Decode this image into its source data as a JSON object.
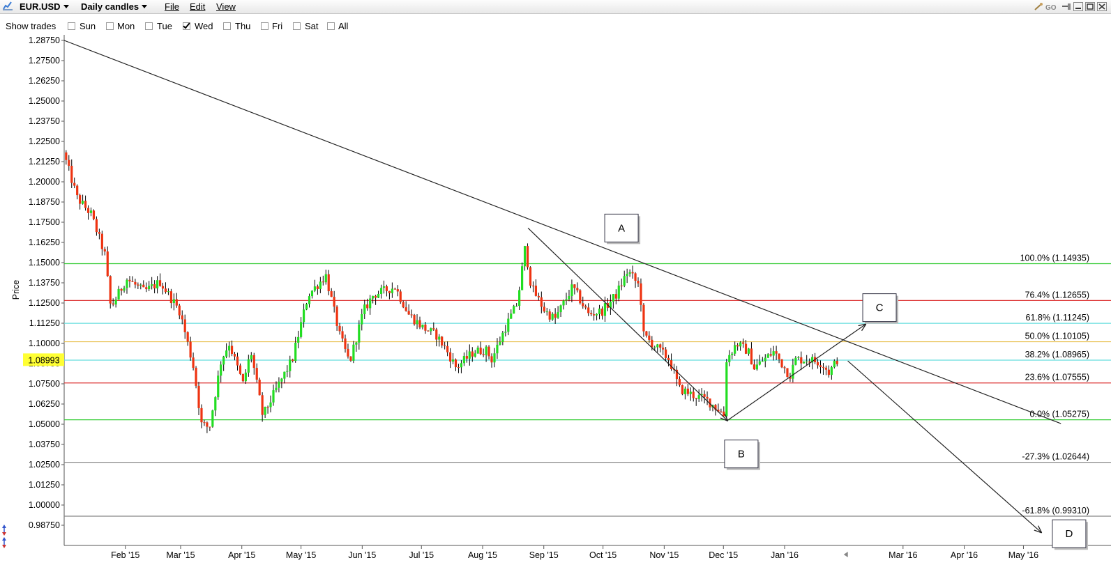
{
  "titlebar": {
    "symbol": "EUR.USD",
    "timeframe": "Daily candles",
    "menus": [
      "File",
      "Edit",
      "View"
    ]
  },
  "trades_bar": {
    "label": "Show trades",
    "options": [
      {
        "label": "Sun",
        "checked": false
      },
      {
        "label": "Mon",
        "checked": false
      },
      {
        "label": "Tue",
        "checked": false
      },
      {
        "label": "Wed",
        "checked": true
      },
      {
        "label": "Thu",
        "checked": false
      },
      {
        "label": "Fri",
        "checked": false
      },
      {
        "label": "Sat",
        "checked": false
      },
      {
        "label": "All",
        "checked": false
      }
    ]
  },
  "colors": {
    "up_candle": "#22dd22",
    "down_candle": "#ee3311",
    "green_level": "#33cc33",
    "red_level": "#dd3333",
    "cyan_level": "#66dddd",
    "orange_level": "#e8c050",
    "gray_level": "#888888",
    "price_badge": "#ffff33"
  },
  "chart_data": {
    "type": "candlestick",
    "ylabel": "Price",
    "ylim": [
      0.98,
      1.29375
    ],
    "y_ticks": [
      "1.28750",
      "1.27500",
      "1.26250",
      "1.25000",
      "1.23750",
      "1.22500",
      "1.21250",
      "1.20000",
      "1.18750",
      "1.17500",
      "1.16250",
      "1.15000",
      "1.13750",
      "1.12500",
      "1.11250",
      "1.10000",
      "1.08750",
      "1.07500",
      "1.06250",
      "1.05000",
      "1.03750",
      "1.02500",
      "1.01250",
      "1.00000",
      "0.98750"
    ],
    "x_ticks": [
      "Feb '15",
      "Mar '15",
      "Apr '15",
      "May '15",
      "Jun '15",
      "Jul '15",
      "Aug '15",
      "Sep '15",
      "Oct '15",
      "Nov '15",
      "Dec '15",
      "Jan '16",
      "Mar '16",
      "Apr '16",
      "May '16"
    ],
    "current_price": "1.08993",
    "fib_levels": [
      {
        "label": "100.0% (1.14935)",
        "value": 1.14935,
        "color": "green"
      },
      {
        "label": "76.4% (1.12655)",
        "value": 1.12655,
        "color": "red"
      },
      {
        "label": "61.8% (1.11245)",
        "value": 1.11245,
        "color": "cyan"
      },
      {
        "label": "50.0% (1.10105)",
        "value": 1.10105,
        "color": "orange"
      },
      {
        "label": "38.2% (1.08965)",
        "value": 1.08965,
        "color": "cyan"
      },
      {
        "label": "23.6% (1.07555)",
        "value": 1.07555,
        "color": "red"
      },
      {
        "label": "0.0% (1.05275)",
        "value": 1.05275,
        "color": "green"
      },
      {
        "label": "-27.3% (1.02644)",
        "value": 1.02644,
        "color": "gray"
      },
      {
        "label": "-61.8% (0.99310)",
        "value": 0.9931,
        "color": "gray"
      }
    ],
    "trendline": {
      "from": {
        "date": "2015-01-01",
        "price": 1.2875
      },
      "to": {
        "date": "2016-05-20",
        "price": 1.0504
      }
    },
    "pattern_points": [
      {
        "label": "A",
        "date": "2015-08-24",
        "price": 1.1714
      },
      {
        "label": "B",
        "date": "2015-12-03",
        "price": 1.0523
      },
      {
        "label": "C",
        "date": "2016-02-11",
        "price": 1.1118
      },
      {
        "label": "D",
        "date": "2016-05-10",
        "price": 0.9831
      }
    ],
    "extra_line": {
      "from": {
        "date": "2016-02-02",
        "price": 1.0892
      },
      "to": {
        "date": "2016-05-10",
        "price": 0.9831
      }
    },
    "anchors": [
      {
        "date": "2015-01-02",
        "price": 1.2182
      },
      {
        "date": "2015-01-09",
        "price": 1.19
      },
      {
        "date": "2015-01-16",
        "price": 1.18
      },
      {
        "date": "2015-01-23",
        "price": 1.155
      },
      {
        "date": "2015-01-26",
        "price": 1.122
      },
      {
        "date": "2015-02-03",
        "price": 1.14
      },
      {
        "date": "2015-02-12",
        "price": 1.132
      },
      {
        "date": "2015-02-20",
        "price": 1.138
      },
      {
        "date": "2015-03-02",
        "price": 1.12
      },
      {
        "date": "2015-03-09",
        "price": 1.085
      },
      {
        "date": "2015-03-13",
        "price": 1.05
      },
      {
        "date": "2015-03-17",
        "price": 1.048
      },
      {
        "date": "2015-03-23",
        "price": 1.09
      },
      {
        "date": "2015-03-27",
        "price": 1.1
      },
      {
        "date": "2015-04-03",
        "price": 1.075
      },
      {
        "date": "2015-04-07",
        "price": 1.095
      },
      {
        "date": "2015-04-13",
        "price": 1.055
      },
      {
        "date": "2015-04-20",
        "price": 1.072
      },
      {
        "date": "2015-04-28",
        "price": 1.09
      },
      {
        "date": "2015-05-06",
        "price": 1.13
      },
      {
        "date": "2015-05-15",
        "price": 1.142
      },
      {
        "date": "2015-05-22",
        "price": 1.105
      },
      {
        "date": "2015-05-27",
        "price": 1.088
      },
      {
        "date": "2015-06-03",
        "price": 1.12
      },
      {
        "date": "2015-06-08",
        "price": 1.13
      },
      {
        "date": "2015-06-19",
        "price": 1.135
      },
      {
        "date": "2015-06-26",
        "price": 1.118
      },
      {
        "date": "2015-07-03",
        "price": 1.11
      },
      {
        "date": "2015-07-10",
        "price": 1.105
      },
      {
        "date": "2015-07-15",
        "price": 1.096
      },
      {
        "date": "2015-07-20",
        "price": 1.085
      },
      {
        "date": "2015-07-29",
        "price": 1.095
      },
      {
        "date": "2015-08-04",
        "price": 1.096
      },
      {
        "date": "2015-08-07",
        "price": 1.09
      },
      {
        "date": "2015-08-14",
        "price": 1.11
      },
      {
        "date": "2015-08-20",
        "price": 1.125
      },
      {
        "date": "2015-08-24",
        "price": 1.16
      },
      {
        "date": "2015-08-27",
        "price": 1.135
      },
      {
        "date": "2015-09-03",
        "price": 1.12
      },
      {
        "date": "2015-09-08",
        "price": 1.115
      },
      {
        "date": "2015-09-17",
        "price": 1.135
      },
      {
        "date": "2015-09-25",
        "price": 1.118
      },
      {
        "date": "2015-10-02",
        "price": 1.12
      },
      {
        "date": "2015-10-09",
        "price": 1.13
      },
      {
        "date": "2015-10-15",
        "price": 1.145
      },
      {
        "date": "2015-10-21",
        "price": 1.135
      },
      {
        "date": "2015-10-23",
        "price": 1.105
      },
      {
        "date": "2015-10-29",
        "price": 1.098
      },
      {
        "date": "2015-11-05",
        "price": 1.09
      },
      {
        "date": "2015-11-10",
        "price": 1.072
      },
      {
        "date": "2015-11-17",
        "price": 1.068
      },
      {
        "date": "2015-11-24",
        "price": 1.065
      },
      {
        "date": "2015-12-01",
        "price": 1.058
      },
      {
        "date": "2015-12-03",
        "price": 1.055
      },
      {
        "date": "2015-12-04",
        "price": 1.09
      },
      {
        "date": "2015-12-09",
        "price": 1.1
      },
      {
        "date": "2015-12-15",
        "price": 1.095
      },
      {
        "date": "2015-12-18",
        "price": 1.085
      },
      {
        "date": "2015-12-28",
        "price": 1.095
      },
      {
        "date": "2016-01-05",
        "price": 1.08
      },
      {
        "date": "2016-01-08",
        "price": 1.09
      },
      {
        "date": "2016-01-15",
        "price": 1.09
      },
      {
        "date": "2016-01-21",
        "price": 1.088
      },
      {
        "date": "2016-01-25",
        "price": 1.082
      },
      {
        "date": "2016-01-29",
        "price": 1.0899
      }
    ]
  }
}
